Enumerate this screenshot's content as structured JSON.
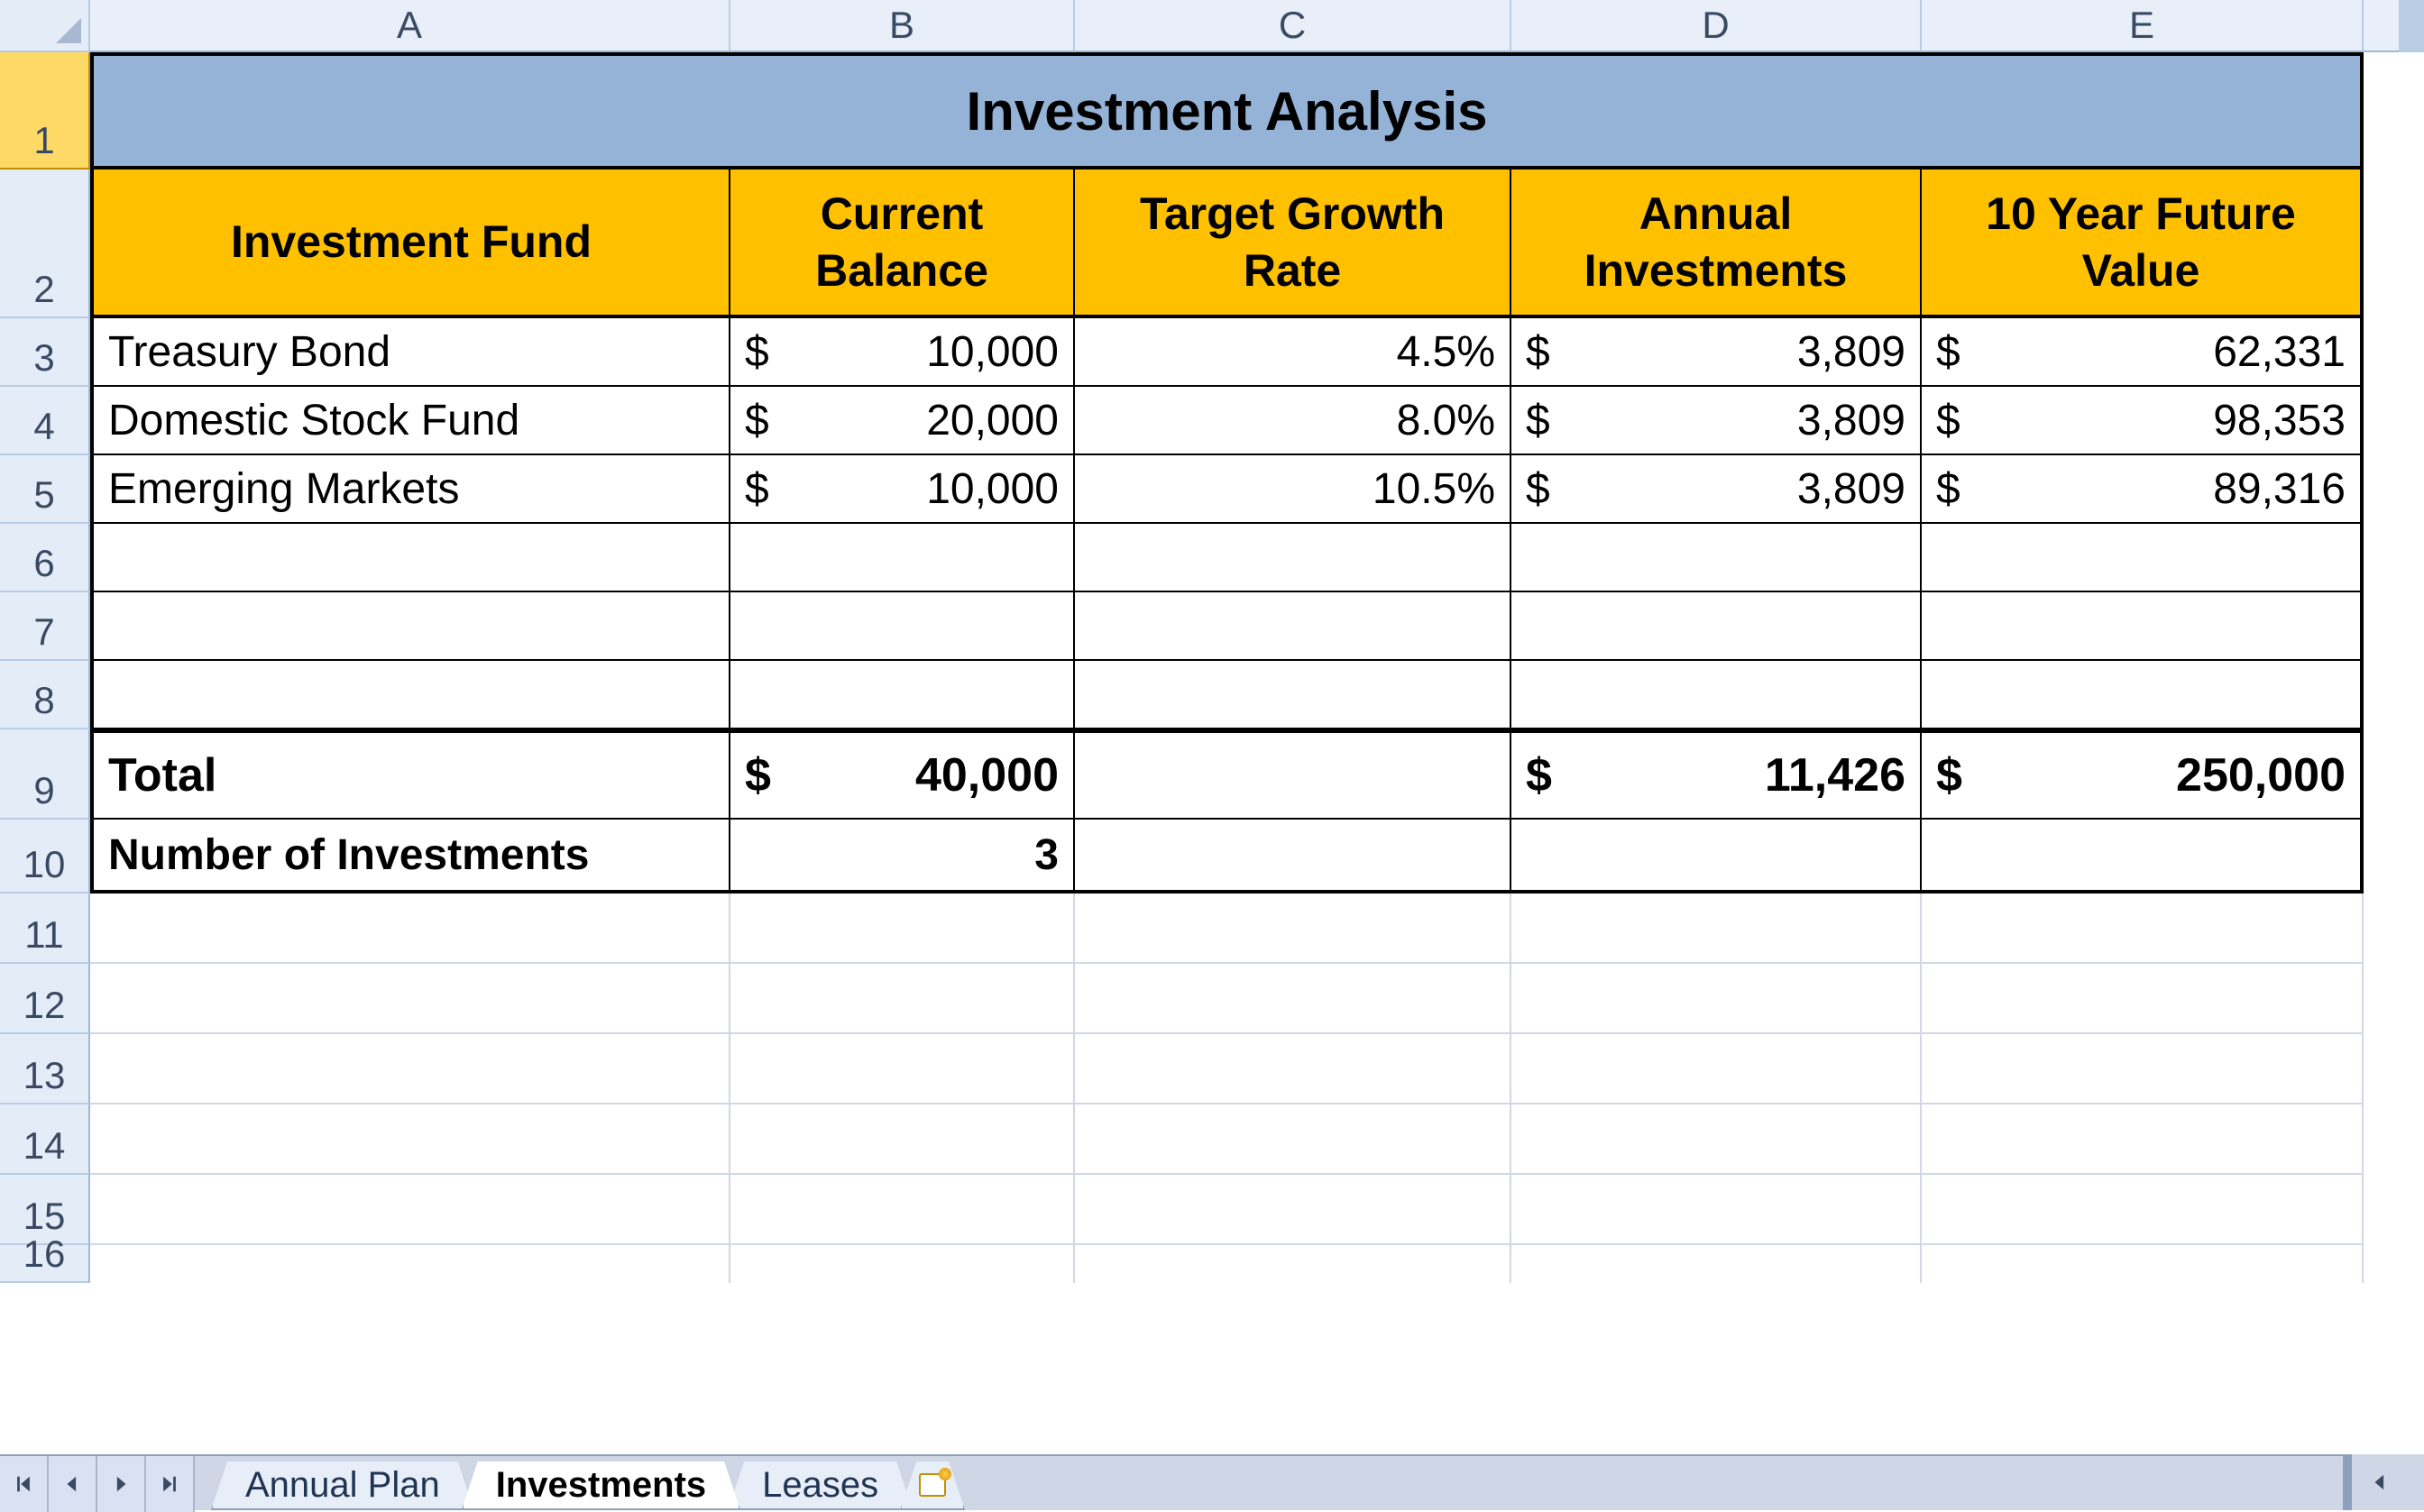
{
  "columns": [
    "A",
    "B",
    "C",
    "D",
    "E"
  ],
  "row_labels": [
    "1",
    "2",
    "3",
    "4",
    "5",
    "6",
    "7",
    "8",
    "9",
    "10",
    "11",
    "12",
    "13",
    "14",
    "15",
    "16"
  ],
  "selected_row": "1",
  "title": "Investment Analysis",
  "headers": {
    "A": "Investment Fund",
    "B": "Current Balance",
    "C": "Target Growth Rate",
    "D": "Annual Investments",
    "E": "10 Year Future Value"
  },
  "data_rows": [
    {
      "fund": "Treasury Bond",
      "balance": "10,000",
      "rate": "4.5%",
      "annual": "3,809",
      "fv": "62,331"
    },
    {
      "fund": "Domestic Stock Fund",
      "balance": "20,000",
      "rate": "8.0%",
      "annual": "3,809",
      "fv": "98,353"
    },
    {
      "fund": "Emerging Markets",
      "balance": "10,000",
      "rate": "10.5%",
      "annual": "3,809",
      "fv": "89,316"
    }
  ],
  "totals": {
    "label": "Total",
    "balance": "40,000",
    "rate": "",
    "annual": "11,426",
    "fv": "250,000"
  },
  "count": {
    "label": "Number of Investments",
    "value": "3"
  },
  "currency_sign": "$",
  "tabs": {
    "items": [
      {
        "label": "Annual Plan",
        "active": false
      },
      {
        "label": "Investments",
        "active": true
      },
      {
        "label": "Leases",
        "active": false
      }
    ]
  }
}
